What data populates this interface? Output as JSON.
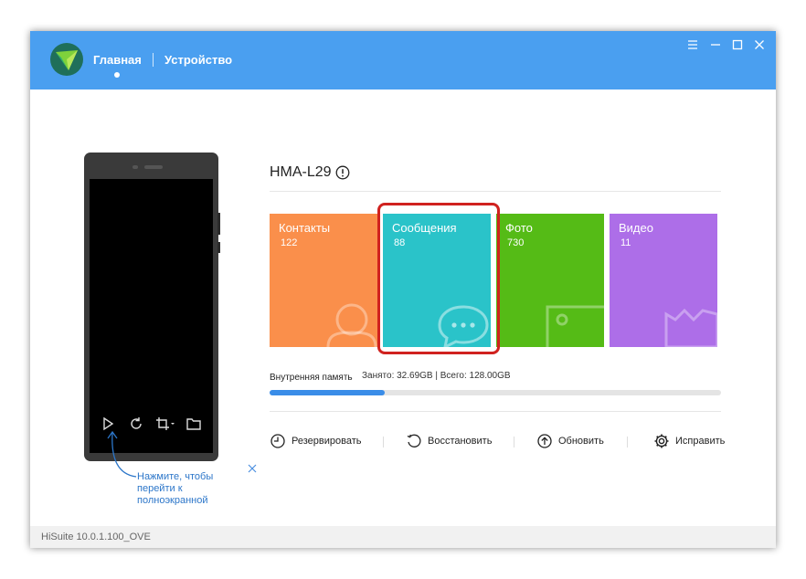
{
  "app": {
    "nav": {
      "home": "Главная",
      "device": "Устройство"
    },
    "version": "HiSuite 10.0.1.100_OVE"
  },
  "colors": {
    "titlebar": "#4a9ff0",
    "contacts": "#fa8f4b",
    "messages": "#2ac3c9",
    "photos": "#55bb16",
    "video": "#ad6ee8",
    "highlight": "#d0221f",
    "storage_fill": "#3a8de8"
  },
  "phone": {
    "hint": "Нажмите, чтобы перейти к полноэкранной",
    "controls": [
      "play-icon",
      "refresh-icon",
      "crop-icon",
      "folder-icon"
    ]
  },
  "device": {
    "model": "HMA-L29",
    "tiles": [
      {
        "label": "Контакты",
        "count": "122"
      },
      {
        "label": "Сообщения",
        "count": "88"
      },
      {
        "label": "Фото",
        "count": "730"
      },
      {
        "label": "Видео",
        "count": "11"
      }
    ],
    "storage": {
      "label": "Внутренняя память",
      "values": "Занято: 32.69GB | Всего: 128.00GB",
      "used_fraction": 0.255
    },
    "actions": [
      {
        "label": "Резервировать",
        "icon": "backup-icon"
      },
      {
        "label": "Восстановить",
        "icon": "restore-icon"
      },
      {
        "label": "Обновить",
        "icon": "update-icon"
      },
      {
        "label": "Исправить",
        "icon": "gear-icon"
      }
    ]
  }
}
